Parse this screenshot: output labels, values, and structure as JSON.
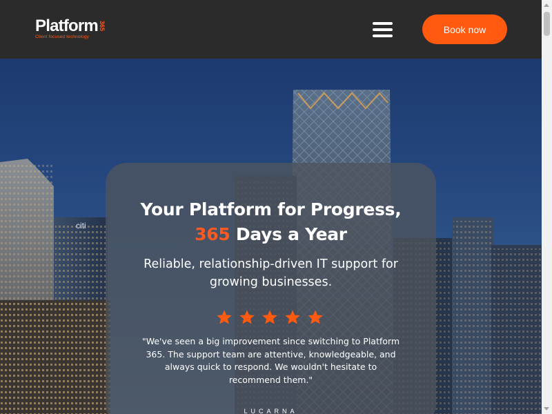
{
  "header": {
    "logo_text": "Platform",
    "logo_number": "365",
    "logo_tagline": "Client focused technology",
    "book_label": "Book now",
    "menu_icon": "hamburger-menu-icon"
  },
  "hero": {
    "title_line1": "Your Platform for Progress,",
    "title_accent": "365",
    "title_line2_rest": " Days a Year",
    "subtitle": "Reliable, relationship-driven IT support for growing businesses.",
    "rating_stars": 5,
    "testimonial": "\"We've seen a big improvement since switching to Platform 365. The support team are attentive, knowledgeable, and always quick to respond. We wouldn't hesitate to recommend them.\"",
    "client_name": "LUCARNA",
    "building_sign": "citi"
  },
  "colors": {
    "accent": "#ff5a10",
    "header_bg": "#2b2b2b",
    "card_bg": "#4e545e"
  }
}
